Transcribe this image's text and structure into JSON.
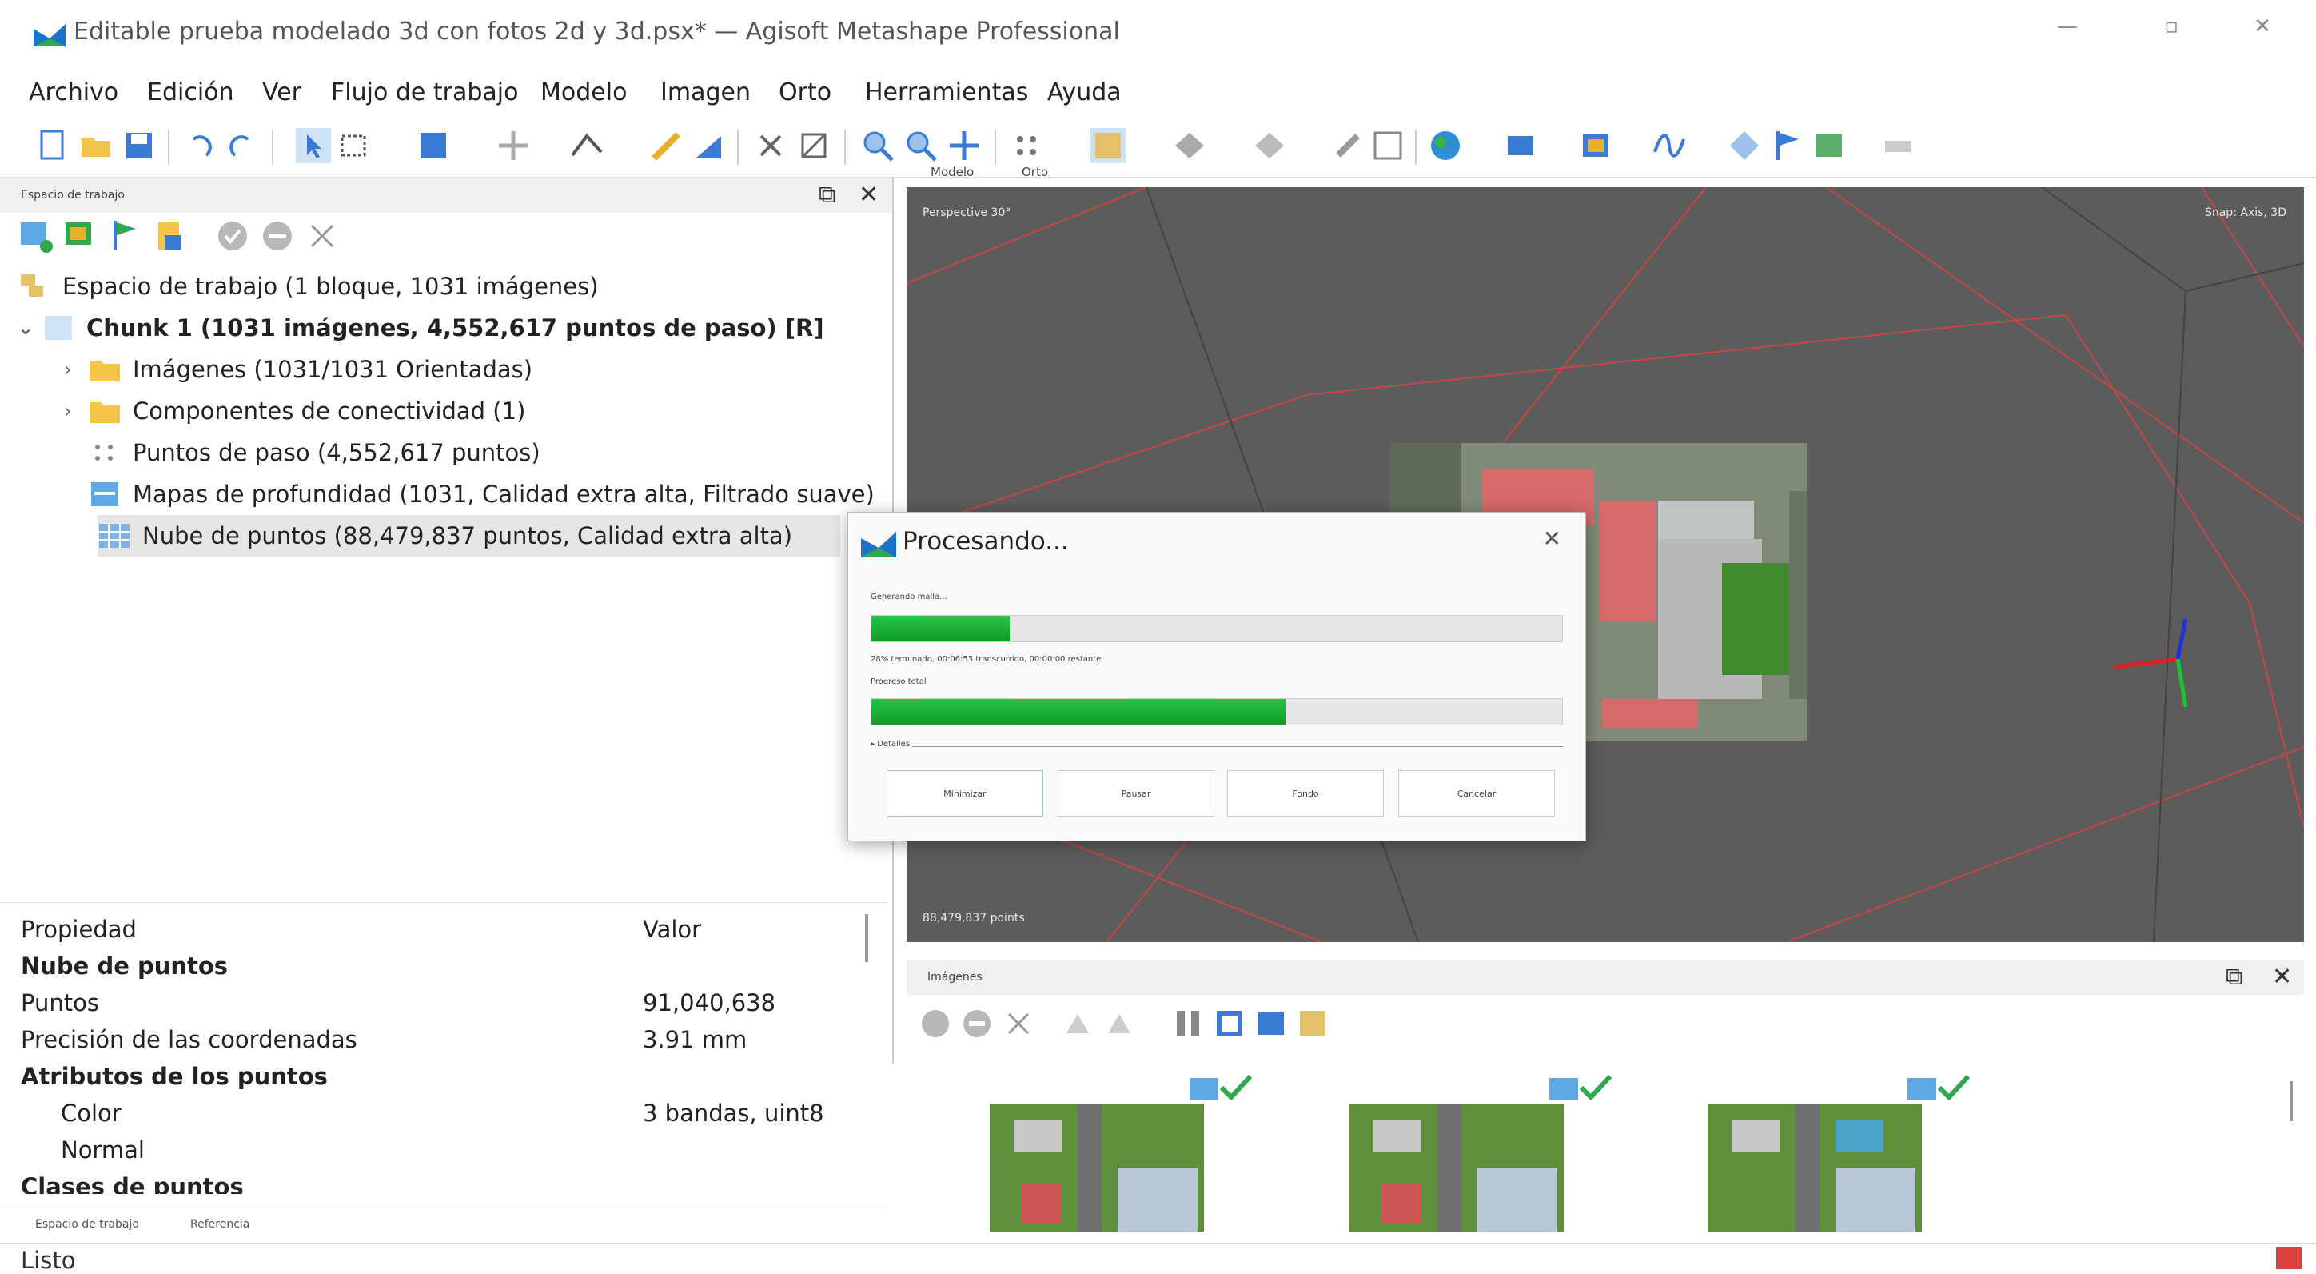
{
  "window": {
    "title": "Editable prueba modelado 3d con fotos 2d y 3d.psx* — Agisoft Metashape Professional",
    "controls": [
      "—",
      "▫",
      "✕"
    ]
  },
  "menu": [
    "Archivo",
    "Edición",
    "Ver",
    "Flujo de trabajo",
    "Modelo",
    "Imagen",
    "Orto",
    "Herramientas",
    "Ayuda"
  ],
  "workspace": {
    "panel_title": "Espacio de trabajo",
    "root": "Espacio de trabajo (1 bloque, 1031 imágenes)",
    "chunk": "Chunk 1 (1031 imágenes, 4,552,617 puntos de paso) [R]",
    "items": [
      "Imágenes (1031/1031 Orientadas)",
      "Componentes de conectividad (1)",
      "Puntos de paso (4,552,617 puntos)",
      "Mapas de profundidad (1031, Calidad extra alta, Filtrado suave)",
      "Nube de puntos (88,479,837 puntos, Calidad extra alta)"
    ]
  },
  "properties": {
    "col_property": "Propiedad",
    "col_value": "Valor",
    "rows": [
      {
        "name": "Nube de puntos",
        "value": "",
        "bold": true
      },
      {
        "name": "Puntos",
        "value": "91,040,638"
      },
      {
        "name": "Precisión de las coordenadas",
        "value": "3.91 mm"
      },
      {
        "name": "Atributos de los puntos",
        "value": "",
        "bold": true
      },
      {
        "name": "Color",
        "value": "3 bandas, uint8",
        "indent": true
      },
      {
        "name": "Normal",
        "value": "",
        "indent": true
      },
      {
        "name": "Clases de puntos",
        "value": "",
        "bold": true
      }
    ]
  },
  "lower_tabs": [
    "Espacio de trabajo",
    "Referencia"
  ],
  "view_tabs": [
    "Modelo",
    "Orto"
  ],
  "viewport": {
    "projection": "Perspective 30°",
    "snap": "Snap: Axis, 3D",
    "points": "88,479,837 points"
  },
  "images_panel": {
    "title": "Imágenes"
  },
  "status": "Listo",
  "dialog": {
    "title": "Procesando...",
    "task_label": "Generando malla...",
    "stage_info": "28% terminado, 00:06:53 transcurrido, 00:00:00 restante",
    "overall_label": "Progreso total",
    "progress_task": 0.2,
    "progress_total": 0.6,
    "details_label": "Detalles",
    "buttons": [
      "Minimizar",
      "Pausar",
      "Fondo",
      "Cancelar"
    ]
  },
  "colors": {
    "accent_green": "#16a834",
    "viewport_bg": "#5c5c5c",
    "bounding_red": "#c64545"
  }
}
